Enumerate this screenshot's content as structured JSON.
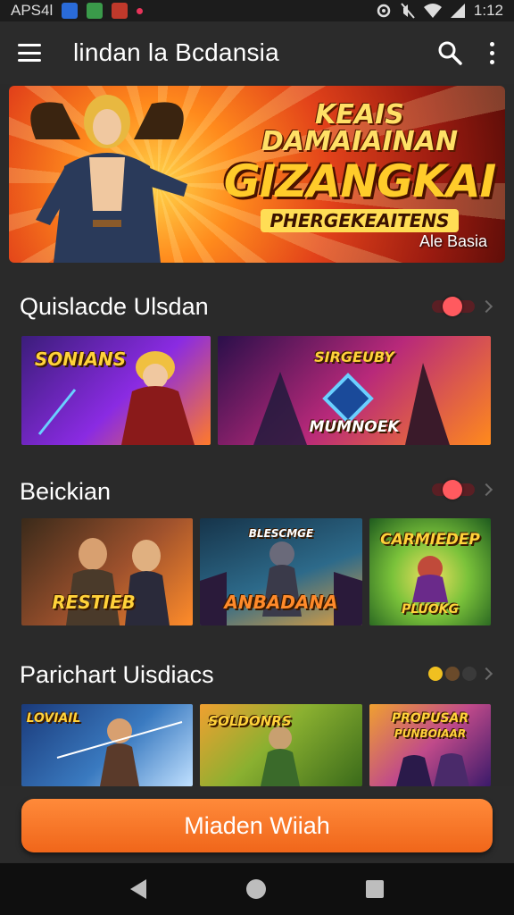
{
  "status_bar": {
    "left_text": "APS4l",
    "time": "1:12",
    "icons": [
      "app-notification-icon",
      "app-notification-icon",
      "app-notification-icon",
      "notification-dot-icon"
    ],
    "right_icons": [
      "sync-icon",
      "mute-icon",
      "wifi-icon",
      "signal-icon"
    ]
  },
  "app_bar": {
    "title": "lindan la Bcdansia",
    "icons": [
      "menu-icon",
      "search-icon",
      "more-vert-icon"
    ]
  },
  "hero": {
    "headline_1": "KEAIS DAMAIAINAN",
    "headline_2": "GIZANGKAI",
    "headline_3": "PHERGEKEAITENS",
    "sub": "Ale Basia"
  },
  "sections": [
    {
      "title": "Quislacde Ulsdan",
      "control": "toggle",
      "tiles": [
        {
          "title": "SONIANS",
          "colors": [
            "#3b1d7a",
            "#8a2be2",
            "#ff7a2a"
          ]
        },
        {
          "title": "SIRGEUBY",
          "subtitle": "MUMNOEK",
          "colors": [
            "#2a0f4a",
            "#b8297a",
            "#ff8a1c"
          ]
        }
      ]
    },
    {
      "title": "Beickian",
      "control": "toggle",
      "tiles": [
        {
          "title": "RESTIEB",
          "colors": [
            "#3a2a1a",
            "#a0522d",
            "#ff8c2a"
          ]
        },
        {
          "title": "BLESCMGE",
          "subtitle": "ANBADANA",
          "colors": [
            "#16344a",
            "#2d6a8a",
            "#e0a040"
          ]
        },
        {
          "title": "CARMIEDEP",
          "subtitle": "PLUOKG",
          "colors": [
            "#1e5a1e",
            "#7ac23a",
            "#f0d02a"
          ]
        }
      ]
    },
    {
      "title": "Parichart Uisdiacs",
      "control": "dots",
      "dots": [
        "#f0c020",
        "#6a4a2a",
        "#3a3a3a"
      ],
      "tiles": [
        {
          "title": "LOVIAIL",
          "colors": [
            "#1a3a7a",
            "#3a7ac0",
            "#c0e0ff"
          ]
        },
        {
          "title": "SOLDONRS",
          "colors": [
            "#3a6a1a",
            "#8ab030",
            "#f0a030"
          ]
        },
        {
          "title": "PROPUSAR",
          "subtitle": "PUNBOIAAR",
          "colors": [
            "#3a1a6a",
            "#c04a8a",
            "#f0a030"
          ]
        }
      ]
    }
  ],
  "cta": {
    "label": "Miaden Wiiah"
  },
  "colors": {
    "accent": "#f27021",
    "toggle_knob": "#ff5a5f",
    "background": "#2a2a2a"
  },
  "nav_bar": {
    "icons": [
      "back-icon",
      "home-icon",
      "recents-icon"
    ]
  }
}
